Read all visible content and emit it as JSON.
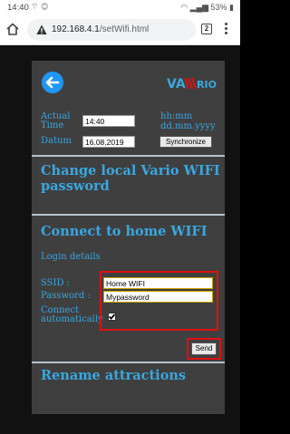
{
  "status_bar": {
    "time": "14:40",
    "notification_icons": "⌔ ◎",
    "battery": "53%"
  },
  "browser": {
    "url_host": "192.168.4.1",
    "url_path": "/setWifi.html",
    "tab_count": "2",
    "security_icon": "warning-triangle-icon"
  },
  "header": {
    "logo_text": "VA",
    "logo_text_2": "RIO"
  },
  "time_section": {
    "actual_time_label": "Actual\nTime",
    "time_value": "14:40",
    "time_format": "hh:mm",
    "datum_label": "Datum",
    "date_value": "16.08.2019",
    "date_format": "dd.mm.yyyy",
    "synchronize_label": "Synchronize"
  },
  "sections": {
    "change_wifi_title": "Change local Vario WIFI password",
    "connect_home_title": "Connect to home WIFI",
    "login_details": "Login details",
    "rename_title": "Rename attractions"
  },
  "wifi_form": {
    "ssid_label": "SSID :",
    "ssid_value": "Home WIFI",
    "password_label": "Password :",
    "password_value": "Mypassword",
    "connect_label": "Connect automatically",
    "connect_checked": true,
    "send_label": "Send"
  },
  "colors": {
    "accent": "#3aa7e0",
    "panel": "#3f3f3f",
    "highlight": "#e01010"
  }
}
